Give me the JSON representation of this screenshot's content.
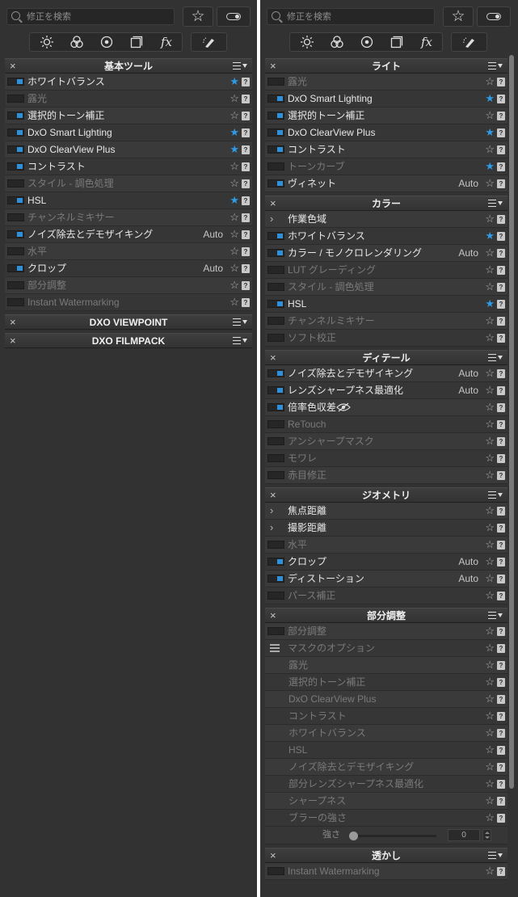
{
  "search_placeholder": "修正を検索",
  "tool_icons": [
    "sun-icon",
    "color-circles-icon",
    "lens-icon",
    "layers-icon",
    "fx-icon"
  ],
  "fx_label": "fx",
  "colors": {
    "accent": "#2e9be6",
    "background": "#323232"
  },
  "left": {
    "sections": [
      {
        "title": "基本ツール",
        "rows": [
          {
            "label": "ホワイトバランス",
            "on": true,
            "fav": true
          },
          {
            "label": "露光",
            "on": false
          },
          {
            "label": "選択的トーン補正",
            "on": true
          },
          {
            "label": "DxO Smart Lighting",
            "on": true,
            "fav": true
          },
          {
            "label": "DxO ClearView Plus",
            "on": true,
            "fav": true
          },
          {
            "label": "コントラスト",
            "on": true
          },
          {
            "label": "スタイル - 調色処理",
            "on": false
          },
          {
            "label": "HSL",
            "on": true,
            "fav": true
          },
          {
            "label": "チャンネルミキサー",
            "on": false
          },
          {
            "label": "ノイズ除去とデモザイキング",
            "on": true,
            "auto": "Auto"
          },
          {
            "label": "水平",
            "on": false
          },
          {
            "label": "クロップ",
            "on": true,
            "auto": "Auto"
          },
          {
            "label": "部分調整",
            "on": false
          },
          {
            "label": "Instant Watermarking",
            "on": false
          }
        ]
      },
      {
        "title": "DXO VIEWPOINT",
        "rows": []
      },
      {
        "title": "DXO FILMPACK",
        "rows": []
      }
    ]
  },
  "right": {
    "sections": [
      {
        "title": "ライト",
        "rows": [
          {
            "label": "露光",
            "on": false
          },
          {
            "label": "DxO Smart Lighting",
            "on": true,
            "fav": true
          },
          {
            "label": "選択的トーン補正",
            "on": true
          },
          {
            "label": "DxO ClearView Plus",
            "on": true,
            "fav": true
          },
          {
            "label": "コントラスト",
            "on": true
          },
          {
            "label": "トーンカーブ",
            "on": false,
            "fav": true
          },
          {
            "label": "ヴィネット",
            "on": true,
            "auto": "Auto"
          }
        ]
      },
      {
        "title": "カラー",
        "rows": [
          {
            "label": "作業色域",
            "type": "chevron"
          },
          {
            "label": "ホワイトバランス",
            "on": true,
            "fav": true
          },
          {
            "label": "カラー / モノクロレンダリング",
            "on": true,
            "auto": "Auto"
          },
          {
            "label": "LUT グレーディング",
            "on": false
          },
          {
            "label": "スタイル - 調色処理",
            "on": false
          },
          {
            "label": "HSL",
            "on": true,
            "fav": true
          },
          {
            "label": "チャンネルミキサー",
            "on": false
          },
          {
            "label": "ソフト校正",
            "on": false
          }
        ]
      },
      {
        "title": "ディテール",
        "rows": [
          {
            "label": "ノイズ除去とデモザイキング",
            "on": true,
            "auto": "Auto"
          },
          {
            "label": "レンズシャープネス最適化",
            "on": true,
            "auto": "Auto"
          },
          {
            "label": "倍率色収差",
            "on": true,
            "eye": true
          },
          {
            "label": "ReTouch",
            "on": false
          },
          {
            "label": "アンシャープマスク",
            "on": false
          },
          {
            "label": "モワレ",
            "on": false
          },
          {
            "label": "赤目修正",
            "on": false
          }
        ]
      },
      {
        "title": "ジオメトリ",
        "rows": [
          {
            "label": "焦点距離",
            "type": "chevron"
          },
          {
            "label": "撮影距離",
            "type": "chevron"
          },
          {
            "label": "水平",
            "on": false
          },
          {
            "label": "クロップ",
            "on": true,
            "auto": "Auto"
          },
          {
            "label": "ディストーション",
            "on": true,
            "auto": "Auto"
          },
          {
            "label": "パース補正",
            "on": false
          }
        ]
      },
      {
        "title": "部分調整",
        "rows": [
          {
            "label": "部分調整",
            "on": false
          },
          {
            "label": "マスクのオプション",
            "type": "sliders",
            "dim": true
          },
          {
            "label": "露光",
            "type": "child",
            "dim": true
          },
          {
            "label": "選択的トーン補正",
            "type": "child",
            "dim": true
          },
          {
            "label": "DxO ClearView Plus",
            "type": "child",
            "dim": true
          },
          {
            "label": "コントラスト",
            "type": "child",
            "dim": true
          },
          {
            "label": "ホワイトバランス",
            "type": "child",
            "dim": true
          },
          {
            "label": "HSL",
            "type": "child",
            "dim": true
          },
          {
            "label": "ノイズ除去とデモザイキング",
            "type": "child",
            "dim": true
          },
          {
            "label": "部分レンズシャープネス最適化",
            "type": "child",
            "dim": true
          },
          {
            "label": "シャープネス",
            "type": "child",
            "dim": true
          },
          {
            "label": "ブラーの強さ",
            "type": "child",
            "dim": true
          }
        ],
        "slider": {
          "label": "強さ",
          "value": "0",
          "level": 0
        }
      },
      {
        "title": "透かし",
        "rows": [
          {
            "label": "Instant Watermarking",
            "on": false
          }
        ]
      }
    ]
  }
}
